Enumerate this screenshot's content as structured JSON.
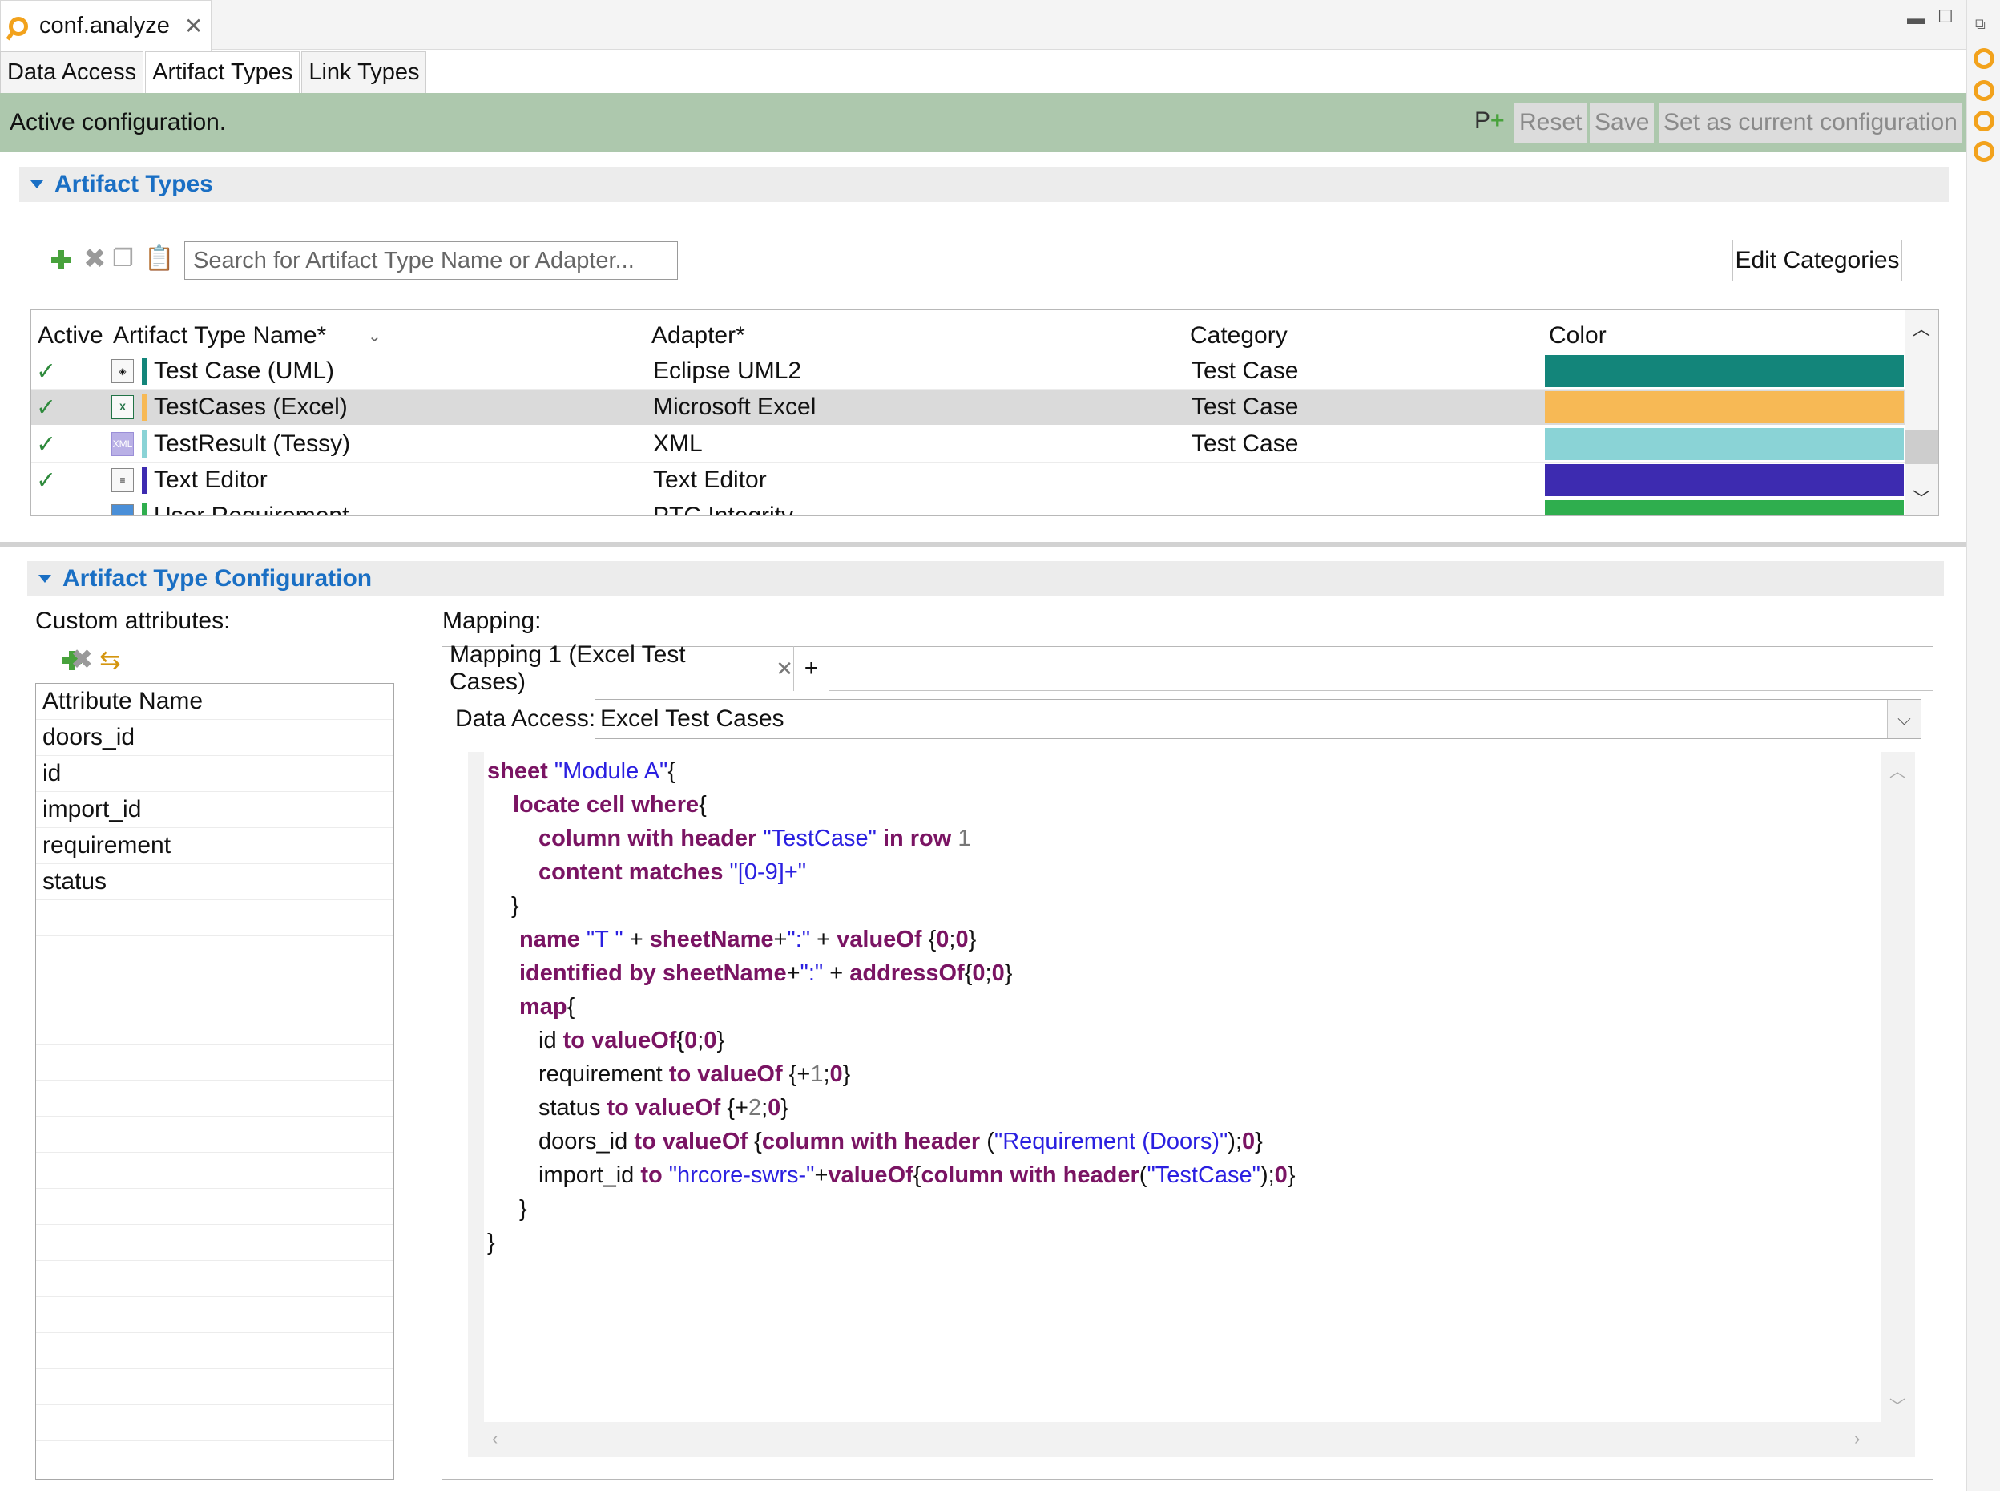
{
  "editor": {
    "tab_title": "conf.analyze",
    "close_glyph": "✕"
  },
  "window_controls": {
    "minimize": "▬",
    "maximize": "☐"
  },
  "page_tabs": [
    {
      "label": "Data Access"
    },
    {
      "label": "Artifact Types",
      "active": true
    },
    {
      "label": "Link Types"
    }
  ],
  "active_bar": {
    "message": "Active configuration.",
    "reset_label": "Reset",
    "save_label": "Save",
    "set_current_label": "Set as current configuration",
    "background": "#adc8ad"
  },
  "artifact_types": {
    "section_title": "Artifact Types",
    "search_placeholder": "Search for Artifact Type Name or Adapter...",
    "edit_categories_label": "Edit Categories",
    "columns": {
      "active": "Active",
      "name": "Artifact Type Name*",
      "adapter": "Adapter*",
      "category": "Category",
      "color": "Color"
    },
    "rows": [
      {
        "active": "✓",
        "name": "Test Case (UML)",
        "adapter": "Eclipse UML2",
        "category": "Test Case",
        "color": "#13857a",
        "icon": "uml-icon"
      },
      {
        "active": "✓",
        "name": "TestCases (Excel)",
        "adapter": "Microsoft Excel",
        "category": "Test Case",
        "color": "#f7b955",
        "icon": "excel-icon",
        "selected": true
      },
      {
        "active": "✓",
        "name": "TestResult (Tessy)",
        "adapter": "XML",
        "category": "Test Case",
        "color": "#8ad3d6",
        "icon": "xml-icon"
      },
      {
        "active": "✓",
        "name": "Text Editor",
        "adapter": "Text Editor",
        "category": "",
        "color": "#3d2bb0",
        "icon": "text-file-icon"
      },
      {
        "active": "",
        "name": "User Requirement",
        "adapter": "PTC Integrity",
        "category": "",
        "color": "#2fae4e",
        "icon": "ptc-icon"
      }
    ]
  },
  "artifact_type_configuration": {
    "section_title": "Artifact Type Configuration",
    "custom_attributes_label": "Custom attributes:",
    "attribute_column": "Attribute Name",
    "attributes": [
      "doors_id",
      "id",
      "import_id",
      "requirement",
      "status"
    ],
    "mapping_label": "Mapping:",
    "mapping_tab": "Mapping 1 (Excel Test Cases)",
    "add_tab": "+",
    "data_access_label": "Data Access:",
    "data_access_value": "Excel Test Cases"
  },
  "code_lines": [
    [
      [
        "kw",
        "sheet"
      ],
      [
        "plain",
        " "
      ],
      [
        "str",
        "\"Module A\""
      ],
      [
        "plain",
        "{"
      ]
    ],
    [
      [
        "kw",
        "locate cell where"
      ],
      [
        "plain",
        "{"
      ]
    ],
    [
      [
        "kw",
        "column with header"
      ],
      [
        "plain",
        " "
      ],
      [
        "str",
        "\"TestCase\""
      ],
      [
        "plain",
        " "
      ],
      [
        "kw",
        "in row"
      ],
      [
        "plain",
        " "
      ],
      [
        "num",
        "1"
      ]
    ],
    [
      [
        "kw",
        "content matches"
      ],
      [
        "plain",
        " "
      ],
      [
        "str",
        "\"[0-9]+\""
      ]
    ],
    [
      [
        "plain",
        "}"
      ]
    ],
    [
      [
        "kw",
        "name"
      ],
      [
        "plain",
        " "
      ],
      [
        "str",
        "\"T \""
      ],
      [
        "plain",
        " + "
      ],
      [
        "kw",
        "sheetName"
      ],
      [
        "plain",
        "+"
      ],
      [
        "str",
        "\":\""
      ],
      [
        "plain",
        " + "
      ],
      [
        "kw",
        "valueOf"
      ],
      [
        "plain",
        " {"
      ],
      [
        "kw",
        "0"
      ],
      [
        "plain",
        ";"
      ],
      [
        "kw",
        "0"
      ],
      [
        "plain",
        "}"
      ]
    ],
    [
      [
        "kw",
        "identified by sheetName"
      ],
      [
        "plain",
        "+"
      ],
      [
        "str",
        "\":\""
      ],
      [
        "plain",
        " + "
      ],
      [
        "kw",
        "addressOf"
      ],
      [
        "plain",
        "{"
      ],
      [
        "kw",
        "0"
      ],
      [
        "plain",
        ";"
      ],
      [
        "kw",
        "0"
      ],
      [
        "plain",
        "}"
      ]
    ],
    [
      [
        "kw",
        "map"
      ],
      [
        "plain",
        "{"
      ]
    ],
    [
      [
        "plain",
        "id "
      ],
      [
        "kw",
        "to valueOf"
      ],
      [
        "plain",
        "{"
      ],
      [
        "kw",
        "0"
      ],
      [
        "plain",
        ";"
      ],
      [
        "kw",
        "0"
      ],
      [
        "plain",
        "}"
      ]
    ],
    [
      [
        "plain",
        "requirement "
      ],
      [
        "kw",
        "to valueOf"
      ],
      [
        "plain",
        " {+"
      ],
      [
        "num",
        "1"
      ],
      [
        "plain",
        ";"
      ],
      [
        "kw",
        "0"
      ],
      [
        "plain",
        "}"
      ]
    ],
    [
      [
        "plain",
        "status "
      ],
      [
        "kw",
        "to valueOf"
      ],
      [
        "plain",
        " {+"
      ],
      [
        "num",
        "2"
      ],
      [
        "plain",
        ";"
      ],
      [
        "kw",
        "0"
      ],
      [
        "plain",
        "}"
      ]
    ],
    [
      [
        "plain",
        "doors_id "
      ],
      [
        "kw",
        "to valueOf"
      ],
      [
        "plain",
        " {"
      ],
      [
        "kw",
        "column with header"
      ],
      [
        "plain",
        " ("
      ],
      [
        "str",
        "\"Requirement (Doors)\""
      ],
      [
        "plain",
        ");"
      ],
      [
        "kw",
        "0"
      ],
      [
        "plain",
        "}"
      ]
    ],
    [
      [
        "plain",
        "import_id "
      ],
      [
        "kw",
        "to"
      ],
      [
        "plain",
        " "
      ],
      [
        "str",
        "\"hrcore-swrs-\""
      ],
      [
        "plain",
        "+"
      ],
      [
        "kw",
        "valueOf"
      ],
      [
        "plain",
        "{"
      ],
      [
        "kw",
        "column with header"
      ],
      [
        "plain",
        "("
      ],
      [
        "str",
        "\"TestCase\""
      ],
      [
        "plain",
        ");"
      ],
      [
        "kw",
        "0"
      ],
      [
        "plain",
        "}"
      ]
    ],
    [
      [
        "plain",
        "}"
      ]
    ],
    [
      [
        "plain",
        "}"
      ]
    ]
  ]
}
